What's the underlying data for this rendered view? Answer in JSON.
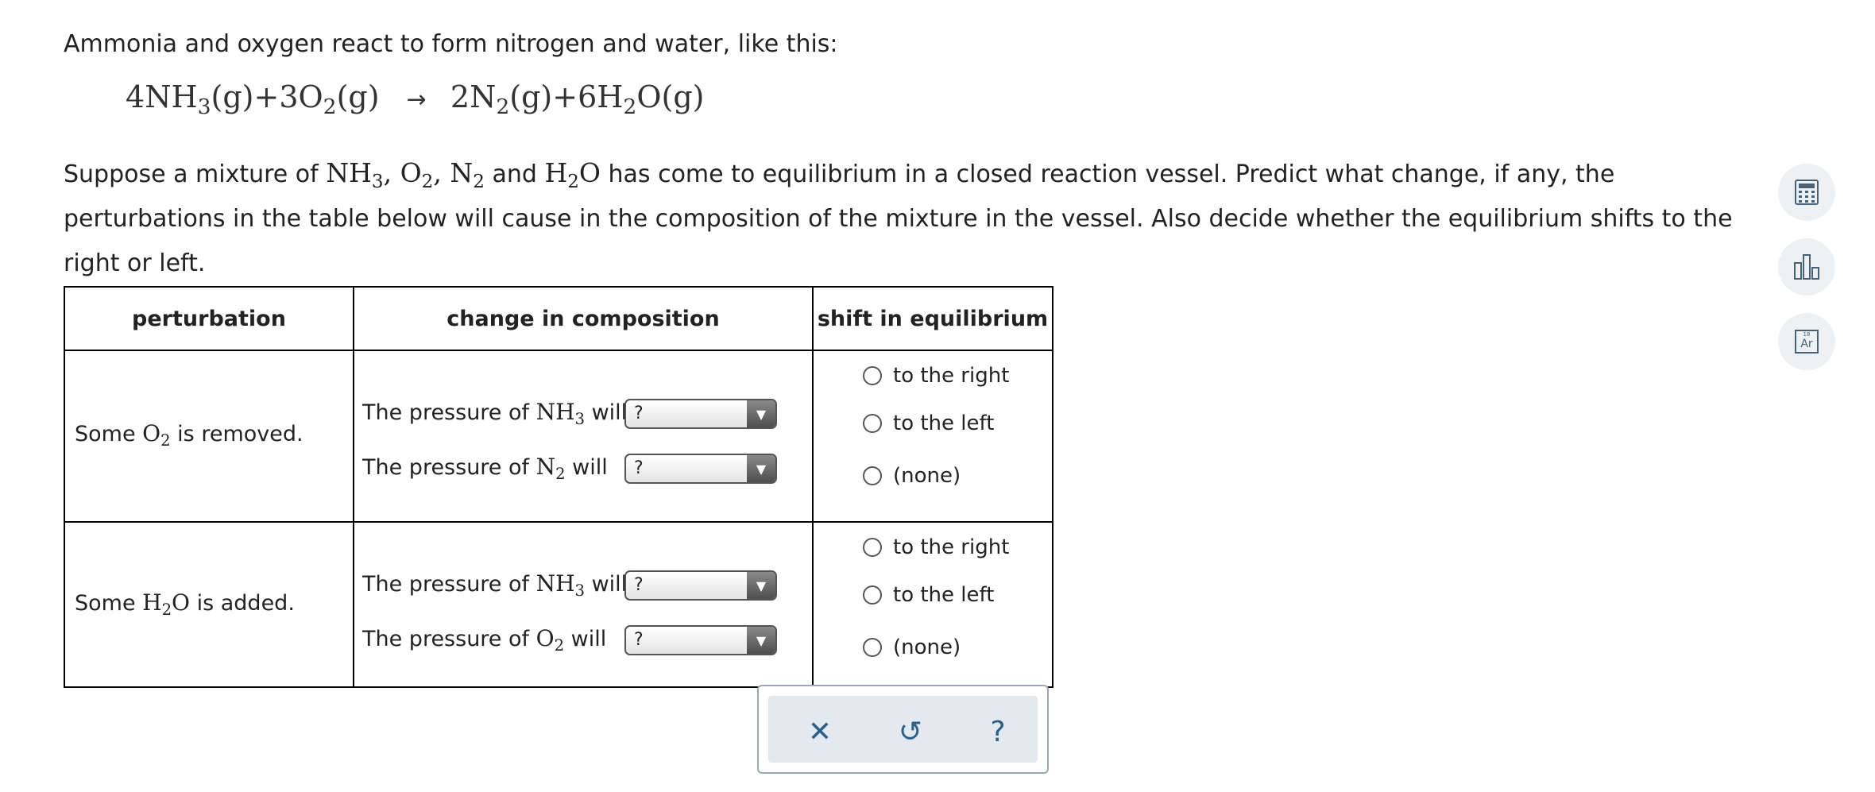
{
  "intro_text": "Ammonia and oxygen react to form nitrogen and water, like this:",
  "equation": {
    "reactants": [
      {
        "coef": "4",
        "base": "NH",
        "sub": "3",
        "state": "(g)"
      },
      {
        "coef": "3",
        "base": "O",
        "sub": "2",
        "state": "(g)"
      }
    ],
    "arrow": "→",
    "products": [
      {
        "coef": "2",
        "base": "N",
        "sub": "2",
        "state": "(g)"
      },
      {
        "coef": "6",
        "base": "H",
        "sub": "2",
        "after": "O",
        "state": "(g)"
      }
    ]
  },
  "description": {
    "part1": "Suppose a mixture of ",
    "part2": " and ",
    "part3": " has come to equilibrium in a closed reaction vessel. Predict what change, if any, the perturbations in the table below will cause in the composition of the mixture in the vessel. Also decide whether the equilibrium shifts to the right or left."
  },
  "table": {
    "headers": [
      "perturbation",
      "change in composition",
      "shift in equilibrium"
    ],
    "rows": [
      {
        "perturbation": {
          "prefix": "Some ",
          "species": "O",
          "sub": "2",
          "suffix": " is removed."
        },
        "changes": [
          {
            "prefix": "The pressure of ",
            "species": "NH",
            "sub": "3",
            "suffix": " will",
            "value": "?"
          },
          {
            "prefix": "The pressure of ",
            "species": "N",
            "sub": "2",
            "suffix": " will",
            "value": "?"
          }
        ],
        "options": [
          "to the right",
          "to the left",
          "(none)"
        ]
      },
      {
        "perturbation": {
          "prefix": "Some ",
          "species": "H",
          "sub": "2",
          "after": "O",
          "suffix": " is added."
        },
        "changes": [
          {
            "prefix": "The pressure of ",
            "species": "NH",
            "sub": "3",
            "suffix": " will",
            "value": "?"
          },
          {
            "prefix": "The pressure of ",
            "species": "O",
            "sub": "2",
            "suffix": " will",
            "value": "?"
          }
        ],
        "options": [
          "to the right",
          "to the left",
          "(none)"
        ]
      }
    ]
  },
  "toolbar": {
    "close_icon": "✕",
    "reset_icon": "↺",
    "help_icon": "?"
  },
  "sidebar": {
    "calculator": "calculator-icon",
    "chart": "bar-chart-icon",
    "periodic": {
      "number": "18",
      "symbol": "Ar"
    }
  },
  "colors": {
    "accent": "#2d5f8b",
    "toolbar_bg": "#e3e9ee"
  }
}
